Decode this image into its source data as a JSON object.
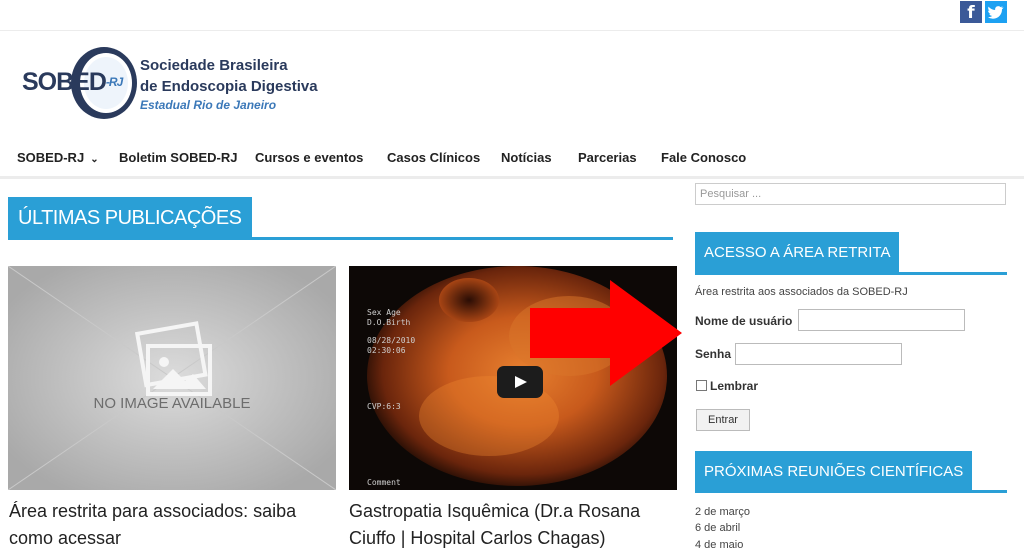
{
  "social": {
    "facebook_glyph": "f",
    "twitter_icon": "twitter-bird-icon",
    "facebook_color": "#3b5998",
    "twitter_color": "#1da1f2"
  },
  "logo": {
    "mark_text": "SOBED",
    "mark_suffix": "-RJ",
    "title_line1": "Sociedade Brasileira",
    "title_line2": "de Endoscopia Digestiva",
    "subtitle": "Estadual Rio de Janeiro"
  },
  "nav": {
    "items": [
      "SOBED-RJ",
      "Boletim SOBED-RJ",
      "Cursos e eventos",
      "Casos Clínicos",
      "Notícias",
      "Parcerias",
      "Fale Conosco"
    ],
    "dropdown_glyph": "⌄"
  },
  "main": {
    "section_title": "ÚLTIMAS PUBLICAÇÕES",
    "posts": [
      {
        "thumb_text": "NO IMAGE AVAILABLE",
        "title": "Área restrita para associados: saiba como acessar"
      },
      {
        "title": "Gastropatia Isquêmica (Dr.a Rosana Ciuffo | Hospital Carlos Chagas)"
      }
    ],
    "video_overlay": [
      "Sex Age",
      "D.O.Birth",
      "08/28/2010",
      "02:30:06",
      "CVP:6:3",
      "Comment"
    ]
  },
  "sidebar": {
    "search_placeholder": "Pesquisar ...",
    "login_widget": {
      "title": "ACESSO A ÁREA RETRITA",
      "description": "Área restrita aos associados da SOBED-RJ",
      "username_label": "Nome de usuário",
      "password_label": "Senha",
      "remember_label": "Lembrar",
      "submit_label": "Entrar"
    },
    "meetings_widget": {
      "title": "PRÓXIMAS REUNIÕES CIENTÍFICAS",
      "dates": [
        "2 de março",
        "6 de abril",
        "4 de maio"
      ]
    }
  },
  "colors": {
    "accent": "#2a9fd6",
    "logo_navy": "#2a3a5c",
    "logo_blue": "#3b78b8",
    "annotation_arrow": "#ff0000"
  }
}
